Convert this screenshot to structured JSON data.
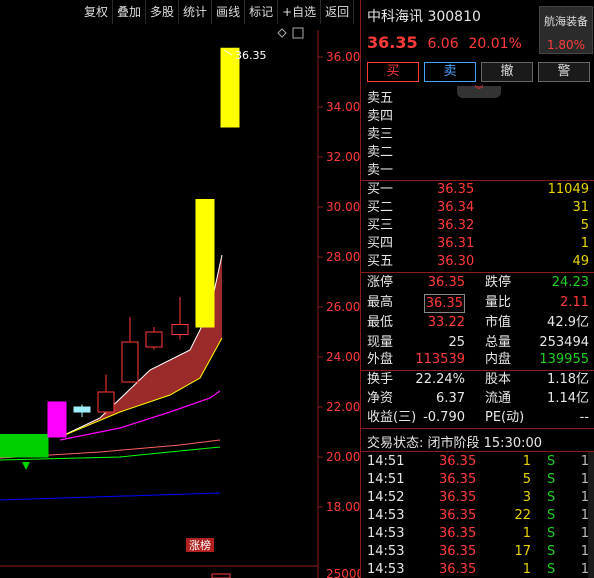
{
  "toolbar": {
    "items": [
      "复权",
      "叠加",
      "多股",
      "统计",
      "画线",
      "标记",
      "+自选",
      "返回"
    ]
  },
  "chart": {
    "y_ticks": [
      "36.00",
      "34.00",
      "32.00",
      "30.00",
      "28.00",
      "26.00",
      "24.00",
      "22.00",
      "20.00",
      "18.00"
    ],
    "high_label": "36.35",
    "bottom_tick": "25000",
    "tag_label": "涨榜",
    "colors": {
      "up": "#ff3b3b",
      "down": "#00d000",
      "limit_up": "#ffff00",
      "ma5": "#ffffff",
      "ma10": "#ffff00",
      "ma20": "#ff00ff",
      "ma60": "#00ff00",
      "ma120": "#0000ff",
      "band": "#9b2a2a"
    }
  },
  "chart_data": {
    "type": "candlestick",
    "ylim": [
      17,
      37
    ],
    "y_ticks": [
      36,
      34,
      32,
      30,
      28,
      26,
      24,
      22,
      20,
      18
    ],
    "candles": [
      {
        "open": 20.9,
        "close": 20.0,
        "high": 20.9,
        "low": 20.0,
        "color": "green"
      },
      {
        "open": 20.9,
        "close": 20.0,
        "high": 20.9,
        "low": 20.0,
        "color": "green"
      },
      {
        "open": 20.8,
        "close": 22.2,
        "high": 22.2,
        "low": 20.8,
        "color": "magenta"
      },
      {
        "open": 21.8,
        "close": 22.0,
        "high": 22.1,
        "low": 21.6,
        "color": "cyan"
      },
      {
        "open": 21.8,
        "close": 22.6,
        "high": 23.3,
        "low": 21.7,
        "color": "up"
      },
      {
        "open": 23.0,
        "close": 24.6,
        "high": 25.6,
        "low": 23.0,
        "color": "up"
      },
      {
        "open": 24.4,
        "close": 25.0,
        "high": 25.2,
        "low": 24.3,
        "color": "up"
      },
      {
        "open": 24.9,
        "close": 25.3,
        "high": 26.4,
        "low": 24.7,
        "color": "up"
      },
      {
        "open": 25.2,
        "close": 30.3,
        "high": 30.3,
        "low": 25.2,
        "color": "limit_up"
      },
      {
        "open": 33.2,
        "close": 36.35,
        "high": 36.35,
        "low": 33.2,
        "color": "limit_up"
      }
    ]
  },
  "quote": {
    "name_code": "中科海讯 300810",
    "price": "36.35",
    "change": "6.06",
    "change_pct": "20.01%",
    "sector_name": "航海装备",
    "sector_pct": "1.80%",
    "actions": [
      "买",
      "卖",
      "撤",
      "警"
    ],
    "asks": [
      "卖五",
      "卖四",
      "卖三",
      "卖二",
      "卖一"
    ],
    "bids": [
      {
        "label": "买一",
        "price": "36.35",
        "vol": "11049"
      },
      {
        "label": "买二",
        "price": "36.34",
        "vol": "31"
      },
      {
        "label": "买三",
        "price": "36.32",
        "vol": "5"
      },
      {
        "label": "买四",
        "price": "36.31",
        "vol": "1"
      },
      {
        "label": "买五",
        "price": "36.30",
        "vol": "49"
      }
    ],
    "stats": [
      {
        "l1": "涨停",
        "v1": "36.35",
        "l2": "跌停",
        "v2": "24.23"
      },
      {
        "l1": "最高",
        "v1": "36.35",
        "l2": "量比",
        "v2": "2.11"
      },
      {
        "l1": "最低",
        "v1": "33.22",
        "l2": "市值",
        "v2": "42.9亿"
      },
      {
        "l1": "现量",
        "v1": "25",
        "l2": "总量",
        "v2": "253494"
      },
      {
        "l1": "外盘",
        "v1": "113539",
        "l2": "内盘",
        "v2": "139955"
      }
    ],
    "stats2": [
      {
        "l1": "换手",
        "v1": "22.24%",
        "l2": "股本",
        "v2": "1.18亿"
      },
      {
        "l1": "净资",
        "v1": "6.37",
        "l2": "流通",
        "v2": "1.14亿"
      },
      {
        "l1": "收益(三)",
        "v1": "-0.790",
        "l2": "PE(动)",
        "v2": "--"
      }
    ],
    "status": "交易状态: 闭市阶段 15:30:00",
    "ticks": [
      {
        "time": "14:51",
        "price": "36.35",
        "vol": "1",
        "side": "S",
        "n": "1"
      },
      {
        "time": "14:51",
        "price": "36.35",
        "vol": "5",
        "side": "S",
        "n": "1"
      },
      {
        "time": "14:52",
        "price": "36.35",
        "vol": "3",
        "side": "S",
        "n": "1"
      },
      {
        "time": "14:53",
        "price": "36.35",
        "vol": "22",
        "side": "S",
        "n": "1"
      },
      {
        "time": "14:53",
        "price": "36.35",
        "vol": "1",
        "side": "S",
        "n": "1"
      },
      {
        "time": "14:53",
        "price": "36.35",
        "vol": "17",
        "side": "S",
        "n": "1"
      },
      {
        "time": "14:53",
        "price": "36.35",
        "vol": "1",
        "side": "S",
        "n": "1"
      }
    ]
  }
}
